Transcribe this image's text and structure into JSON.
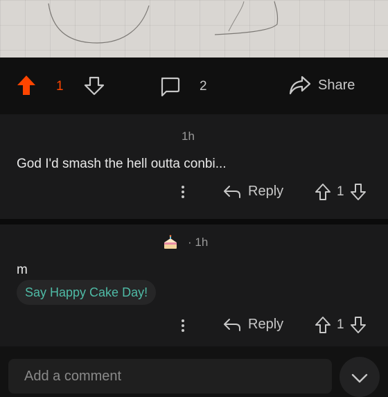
{
  "post": {
    "vote_count": "1",
    "comment_count": "2",
    "share_label": "Share"
  },
  "comments": [
    {
      "time": "1h",
      "text": "God I'd smash the hell outta conbi...",
      "reply_label": "Reply",
      "vote_count": "1"
    },
    {
      "time": "· 1h",
      "text": "m",
      "cake_day_label": "Say Happy Cake Day!",
      "reply_label": "Reply",
      "vote_count": "1"
    }
  ],
  "composer": {
    "placeholder": "Add a comment"
  },
  "colors": {
    "upvote_active": "#ff4500",
    "cake_day_text": "#4fbba6"
  },
  "icons": [
    "upvote-icon",
    "downvote-icon",
    "comment-icon",
    "share-icon",
    "more-icon",
    "reply-icon",
    "cake-icon",
    "chevron-down-icon"
  ]
}
